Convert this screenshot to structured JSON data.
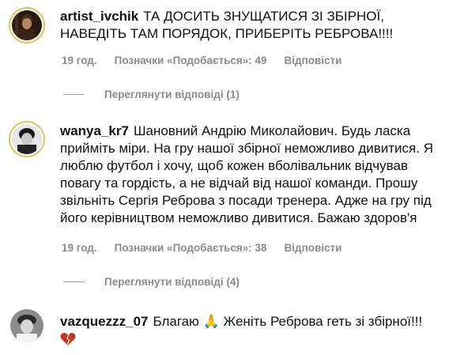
{
  "comments": [
    {
      "username": "artist_ivchik",
      "text": "ТА ДОСИТЬ ЗНУЩАТИСЯ ЗІ ЗБІРНОЇ, НАВЕДІТЬ ТАМ ПОРЯДОК, ПРИБЕРІТЬ РЕБРОВА!!!!",
      "time": "19 год.",
      "likes": "Позначки «Подобається»: 49",
      "reply": "Відповісти",
      "view_replies": "Переглянути відповіді (1)"
    },
    {
      "username": "wanya_kr7",
      "text": "Шановний Андрію Миколайович. Будь ласка прийміть міри. На гру нашої збірної неможливо дивитися. Я люблю футбол і хочу, щоб кожен вболівальник відчував повагу та гордість, а не відчай від нашої команди. Прошу звільніть Сергія Реброва з посади тренера. Адже на гру під його керівництвом неможливо дивитися. Бажаю здоров'я",
      "time": "19 год.",
      "likes": "Позначки «Подобається»: 38",
      "reply": "Відповісти",
      "view_replies": "Переглянути відповіді (4)"
    },
    {
      "username": "vazquezzz_07",
      "text": "Благаю 🙏 Женіть Реброва геть зі збірної!!!",
      "broken_heart": "💔"
    }
  ],
  "icons": [
    "avatar-artist",
    "avatar-wanya",
    "avatar-vazquez",
    "broken-heart-icon"
  ],
  "colors": {
    "meta": "#8a8a8a",
    "ring": "#d4c66a",
    "heart": "#c0392b"
  }
}
